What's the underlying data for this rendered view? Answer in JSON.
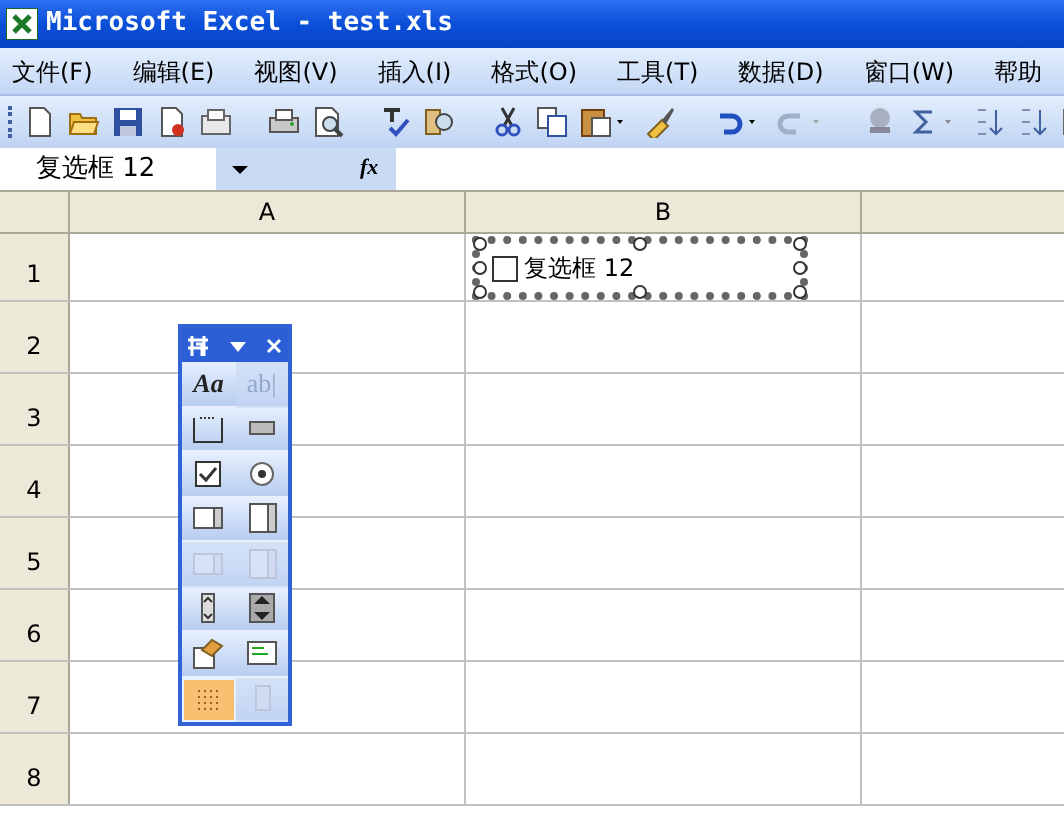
{
  "window": {
    "title": "Microsoft Excel - test.xls"
  },
  "menu": [
    {
      "label": "文件(F)"
    },
    {
      "label": "编辑(E)"
    },
    {
      "label": "视图(V)"
    },
    {
      "label": "插入(I)"
    },
    {
      "label": "格式(O)"
    },
    {
      "label": "工具(T)"
    },
    {
      "label": "数据(D)"
    },
    {
      "label": "窗口(W)"
    },
    {
      "label": "帮助"
    }
  ],
  "name_box": {
    "value": "复选框 12"
  },
  "formula_bar": {
    "fx": "fx"
  },
  "columns": [
    "A",
    "B"
  ],
  "rows": [
    "1",
    "2",
    "3",
    "4",
    "5",
    "6",
    "7",
    "8"
  ],
  "checkbox_control": {
    "label": "复选框 12",
    "checked": false,
    "selected": true
  },
  "forms_toolbar": {
    "buttons": [
      {
        "kind": "label",
        "glyph": "Aa",
        "disabled": false,
        "selected": false
      },
      {
        "kind": "editbox",
        "glyph": "ab|",
        "disabled": true,
        "selected": false
      },
      {
        "kind": "groupbox",
        "disabled": false,
        "selected": false
      },
      {
        "kind": "button",
        "disabled": false,
        "selected": false
      },
      {
        "kind": "checkbox",
        "disabled": false,
        "selected": false
      },
      {
        "kind": "radio",
        "disabled": false,
        "selected": false
      },
      {
        "kind": "listbox",
        "disabled": false,
        "selected": false
      },
      {
        "kind": "combobox",
        "disabled": false,
        "selected": false
      },
      {
        "kind": "comboedit",
        "disabled": true,
        "selected": false
      },
      {
        "kind": "combodrop",
        "disabled": true,
        "selected": false
      },
      {
        "kind": "scrollbar",
        "disabled": false,
        "selected": false
      },
      {
        "kind": "spinner",
        "disabled": false,
        "selected": false
      },
      {
        "kind": "properties",
        "disabled": false,
        "selected": false
      },
      {
        "kind": "code",
        "disabled": false,
        "selected": false
      },
      {
        "kind": "grid",
        "disabled": false,
        "selected": true
      },
      {
        "kind": "rundialog",
        "disabled": true,
        "selected": false
      }
    ]
  }
}
